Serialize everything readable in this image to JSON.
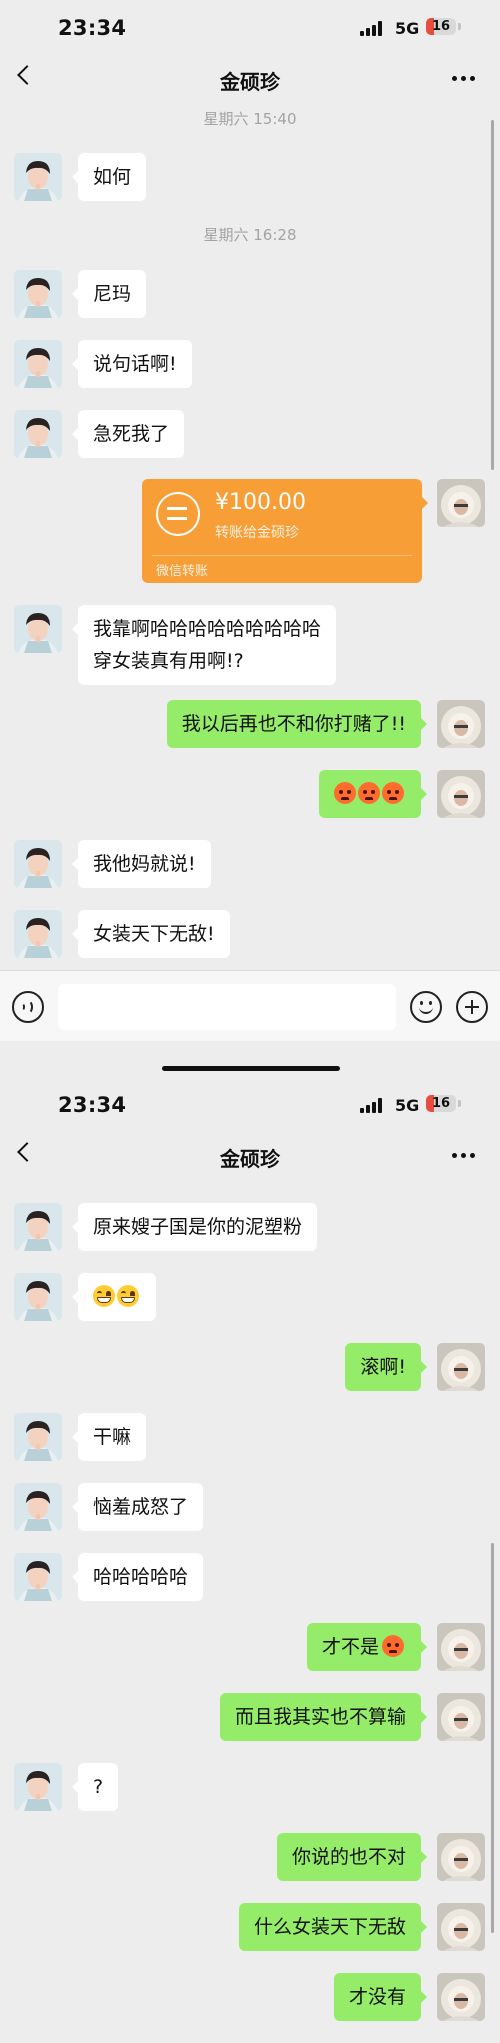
{
  "panel1": {
    "status": {
      "time": "23:34",
      "network": "5G",
      "battery": "16"
    },
    "nav": {
      "title": "金硕珍"
    },
    "timestamps": [
      "星期六 15:40",
      "星期六 16:28"
    ],
    "messages": [
      {
        "text": "如何"
      },
      {
        "text": "尼玛"
      },
      {
        "text": "说句话啊!"
      },
      {
        "text": "急死我了"
      },
      {
        "text": "我靠啊哈哈哈哈哈哈哈哈哈"
      },
      {
        "text": "穿女装真有用啊!?"
      },
      {
        "text": "我以后再也不和你打赌了!!"
      },
      {
        "text": "我他妈就说!"
      },
      {
        "text": "女装天下无敌!"
      }
    ],
    "transfer": {
      "amount": "¥100.00",
      "desc": "转账给金硕珍",
      "footer": "微信转账"
    }
  },
  "panel2": {
    "status": {
      "time": "23:34",
      "network": "5G",
      "battery": "16"
    },
    "nav": {
      "title": "金硕珍"
    },
    "messages": [
      {
        "text": "原来嫂子国是你的泥塑粉"
      },
      {
        "text": "滚啊!"
      },
      {
        "text": "干嘛"
      },
      {
        "text": "恼羞成怒了"
      },
      {
        "text": "哈哈哈哈哈"
      },
      {
        "text": "才不是"
      },
      {
        "text": "而且我其实也不算输"
      },
      {
        "text": "?"
      },
      {
        "text": "你说的也不对"
      },
      {
        "text": "什么女装天下无敌"
      },
      {
        "text": "才没有"
      }
    ]
  },
  "colors": {
    "background": "#ededed",
    "bubble_self": "#95ec69",
    "bubble_other": "#ffffff",
    "transfer": "#f79e37"
  }
}
